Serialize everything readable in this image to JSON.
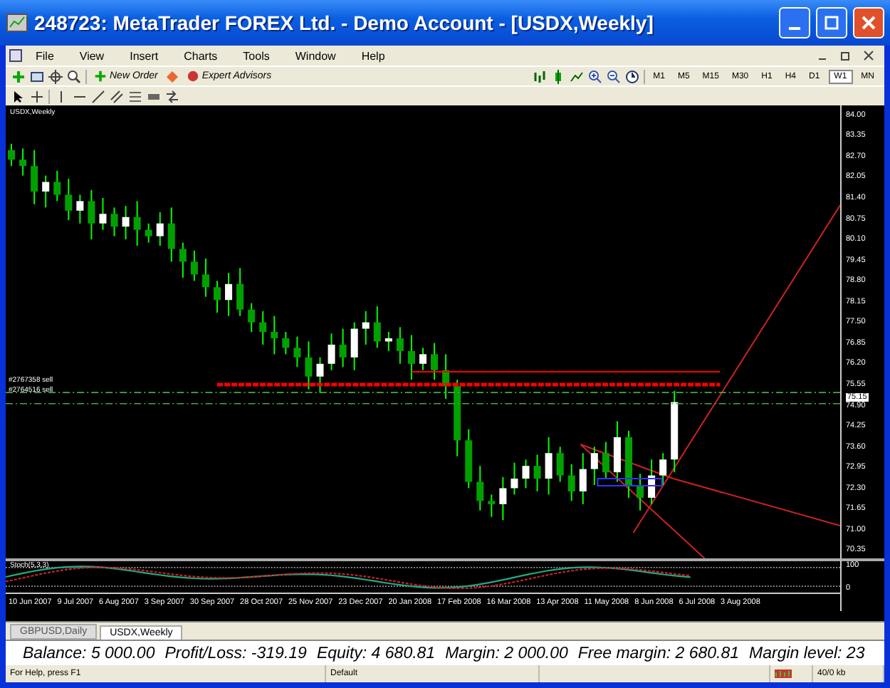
{
  "window": {
    "title": "248723: MetaTrader FOREX Ltd. - Demo Account - [USDX,Weekly]"
  },
  "menu": [
    "File",
    "View",
    "Insert",
    "Charts",
    "Tools",
    "Window",
    "Help"
  ],
  "toolbar": {
    "buttons": [
      "New Order",
      "Expert Advisors"
    ],
    "timeframes": [
      {
        "label": "M1",
        "selected": false
      },
      {
        "label": "M5",
        "selected": false
      },
      {
        "label": "M15",
        "selected": false
      },
      {
        "label": "M30",
        "selected": false
      },
      {
        "label": "H1",
        "selected": false
      },
      {
        "label": "H4",
        "selected": false
      },
      {
        "label": "D1",
        "selected": false
      },
      {
        "label": "W1",
        "selected": true
      },
      {
        "label": "MN",
        "selected": false
      }
    ]
  },
  "chart": {
    "label": "USDX,Weekly",
    "chart_data": {
      "type": "candlestick",
      "ylim": [
        70.1,
        84.3
      ],
      "ref_lines": [
        {
          "axis": "y",
          "value": 75.95,
          "color": "#ff0000"
        },
        {
          "axis": "y",
          "value": 75.55,
          "color": "#ff0000"
        },
        {
          "axis": "y",
          "value": 75.3,
          "color": "#44aa44"
        },
        {
          "axis": "y",
          "value": 74.95,
          "color": "#44aa44"
        }
      ],
      "categories": [
        null,
        null,
        null,
        null,
        null,
        null,
        null,
        null,
        null,
        null,
        null,
        null,
        null,
        null,
        null,
        null,
        null,
        null,
        null,
        null,
        null,
        null,
        null,
        null,
        null,
        null,
        null,
        null,
        null,
        null,
        null,
        null,
        null,
        null,
        null,
        null,
        null,
        null,
        null,
        null,
        null,
        null,
        null,
        null,
        null,
        null,
        null,
        null,
        null,
        null,
        null,
        null,
        null,
        null,
        null,
        null,
        null,
        null,
        null,
        null,
        null,
        null,
        null,
        null,
        null,
        null,
        null,
        null,
        null,
        null,
        null,
        null,
        null
      ],
      "yticks": [
        {
          "value": 84.0,
          "label": "84.00"
        },
        {
          "value": 83.35,
          "label": "83.35"
        },
        {
          "value": 82.7,
          "label": "82.70"
        },
        {
          "value": 82.05,
          "label": "82.05"
        },
        {
          "value": 81.4,
          "label": "81.40"
        },
        {
          "value": 80.75,
          "label": "80.75"
        },
        {
          "value": 80.1,
          "label": "80.10"
        },
        {
          "value": 79.45,
          "label": "79.45"
        },
        {
          "value": 78.8,
          "label": "78.80"
        },
        {
          "value": 78.15,
          "label": "78.15"
        },
        {
          "value": 77.5,
          "label": "77.50"
        },
        {
          "value": 76.85,
          "label": "76.85"
        },
        {
          "value": 76.2,
          "label": "76.20"
        },
        {
          "value": 75.55,
          "label": "75.55"
        },
        {
          "value": 74.9,
          "label": "74.90"
        },
        {
          "value": 74.25,
          "label": "74.25"
        },
        {
          "value": 73.6,
          "label": "73.60"
        },
        {
          "value": 72.95,
          "label": "72.95"
        },
        {
          "value": 72.3,
          "label": "72.30"
        },
        {
          "value": 71.65,
          "label": "71.65"
        },
        {
          "value": 71.0,
          "label": "71.00"
        },
        {
          "value": 70.35,
          "label": "70.35"
        }
      ],
      "ohlc": [
        [
          82.9,
          83.1,
          82.4,
          82.6
        ],
        [
          82.6,
          82.95,
          82.1,
          82.4
        ],
        [
          82.4,
          82.9,
          81.2,
          81.6
        ],
        [
          81.6,
          82.1,
          81.1,
          81.9
        ],
        [
          81.9,
          82.25,
          81.3,
          81.5
        ],
        [
          81.5,
          82.0,
          80.7,
          81.0
        ],
        [
          81.0,
          81.5,
          80.6,
          81.3
        ],
        [
          81.3,
          81.65,
          80.1,
          80.6
        ],
        [
          80.6,
          81.4,
          80.4,
          80.9
        ],
        [
          80.9,
          81.1,
          80.2,
          80.5
        ],
        [
          80.5,
          81.15,
          80.1,
          80.8
        ],
        [
          80.8,
          81.3,
          79.9,
          80.4
        ],
        [
          80.4,
          80.6,
          80.0,
          80.2
        ],
        [
          80.2,
          80.95,
          79.9,
          80.6
        ],
        [
          80.6,
          81.1,
          79.4,
          79.8
        ],
        [
          79.8,
          80.0,
          78.9,
          79.4
        ],
        [
          79.4,
          79.75,
          78.8,
          79.0
        ],
        [
          79.0,
          79.5,
          78.3,
          78.6
        ],
        [
          78.6,
          78.8,
          77.8,
          78.2
        ],
        [
          78.2,
          79.05,
          77.7,
          78.7
        ],
        [
          78.7,
          79.2,
          77.7,
          77.9
        ],
        [
          77.9,
          78.1,
          77.2,
          77.5
        ],
        [
          77.5,
          77.85,
          76.8,
          77.2
        ],
        [
          77.2,
          77.7,
          76.5,
          77.0
        ],
        [
          77.0,
          77.2,
          76.5,
          76.7
        ],
        [
          76.7,
          77.05,
          76.1,
          76.4
        ],
        [
          76.4,
          76.9,
          75.4,
          75.8
        ],
        [
          75.8,
          76.4,
          75.3,
          76.2
        ],
        [
          76.2,
          77.15,
          76.0,
          76.8
        ],
        [
          76.8,
          77.3,
          76.1,
          76.4
        ],
        [
          76.4,
          77.5,
          76.0,
          77.3
        ],
        [
          77.3,
          77.85,
          76.8,
          77.5
        ],
        [
          77.5,
          78.0,
          76.7,
          76.9
        ],
        [
          76.9,
          77.2,
          76.6,
          77.0
        ],
        [
          77.0,
          77.35,
          76.2,
          76.6
        ],
        [
          76.6,
          77.1,
          75.7,
          76.2
        ],
        [
          76.2,
          76.7,
          76.0,
          76.5
        ],
        [
          76.5,
          76.85,
          75.7,
          76.0
        ],
        [
          76.0,
          76.5,
          75.1,
          75.5
        ],
        [
          75.5,
          75.7,
          73.3,
          73.8
        ],
        [
          73.8,
          74.15,
          72.3,
          72.5
        ],
        [
          72.5,
          73.0,
          71.6,
          71.9
        ],
        [
          71.9,
          72.1,
          71.4,
          71.8
        ],
        [
          71.8,
          72.65,
          71.3,
          72.3
        ],
        [
          72.3,
          73.1,
          72.1,
          72.6
        ],
        [
          72.6,
          73.2,
          72.3,
          73.0
        ],
        [
          73.0,
          73.35,
          72.2,
          72.6
        ],
        [
          72.6,
          73.9,
          72.1,
          73.4
        ],
        [
          73.4,
          73.6,
          72.5,
          72.7
        ],
        [
          72.7,
          73.05,
          71.9,
          72.2
        ],
        [
          72.2,
          73.4,
          71.8,
          72.9
        ],
        [
          72.9,
          73.6,
          72.4,
          73.4
        ],
        [
          73.4,
          73.75,
          72.6,
          72.8
        ],
        [
          72.8,
          74.4,
          72.5,
          73.9
        ],
        [
          73.9,
          74.1,
          72.0,
          72.4
        ],
        [
          72.4,
          72.75,
          71.6,
          72.0
        ],
        [
          72.0,
          73.2,
          71.8,
          72.7
        ],
        [
          72.7,
          73.4,
          72.4,
          73.2
        ],
        [
          73.2,
          75.35,
          72.8,
          75.0
        ],
        null,
        null,
        null,
        null,
        null,
        null,
        null,
        null,
        null,
        null,
        null,
        null,
        null,
        null
      ]
    },
    "order_labels": [
      "#2767358 sell",
      "#2764516 sell"
    ],
    "current_price": "75.15",
    "indicator": {
      "label": "Stoch(5,3,3)",
      "axis": [
        "100",
        "0"
      ]
    },
    "date_axis": [
      "10 Jun 2007",
      "9 Jul 2007",
      "6 Aug 2007",
      "3 Sep 2007",
      "30 Sep 2007",
      "28 Oct 2007",
      "25 Nov 2007",
      "23 Dec 2007",
      "20 Jan 2008",
      "17 Feb 2008",
      "16 Mar 2008",
      "13 Apr 2008",
      "11 May 2008",
      "8 Jun 2008",
      "6 Jul 2008",
      "3 Aug 2008"
    ]
  },
  "chart_tabs": [
    {
      "label": "GBPUSD,Daily",
      "selected": false
    },
    {
      "label": "USDX,Weekly",
      "selected": true
    }
  ],
  "terminal": [
    "Balance: 5 000.00",
    "Profit/Loss: -319.19",
    "Equity: 4 680.81",
    "Margin: 2 000.00",
    "Free margin: 2 680.81",
    "Margin level: 23"
  ],
  "status_bar": [
    "For Help, press F1",
    "Default",
    "40/0 kb"
  ]
}
